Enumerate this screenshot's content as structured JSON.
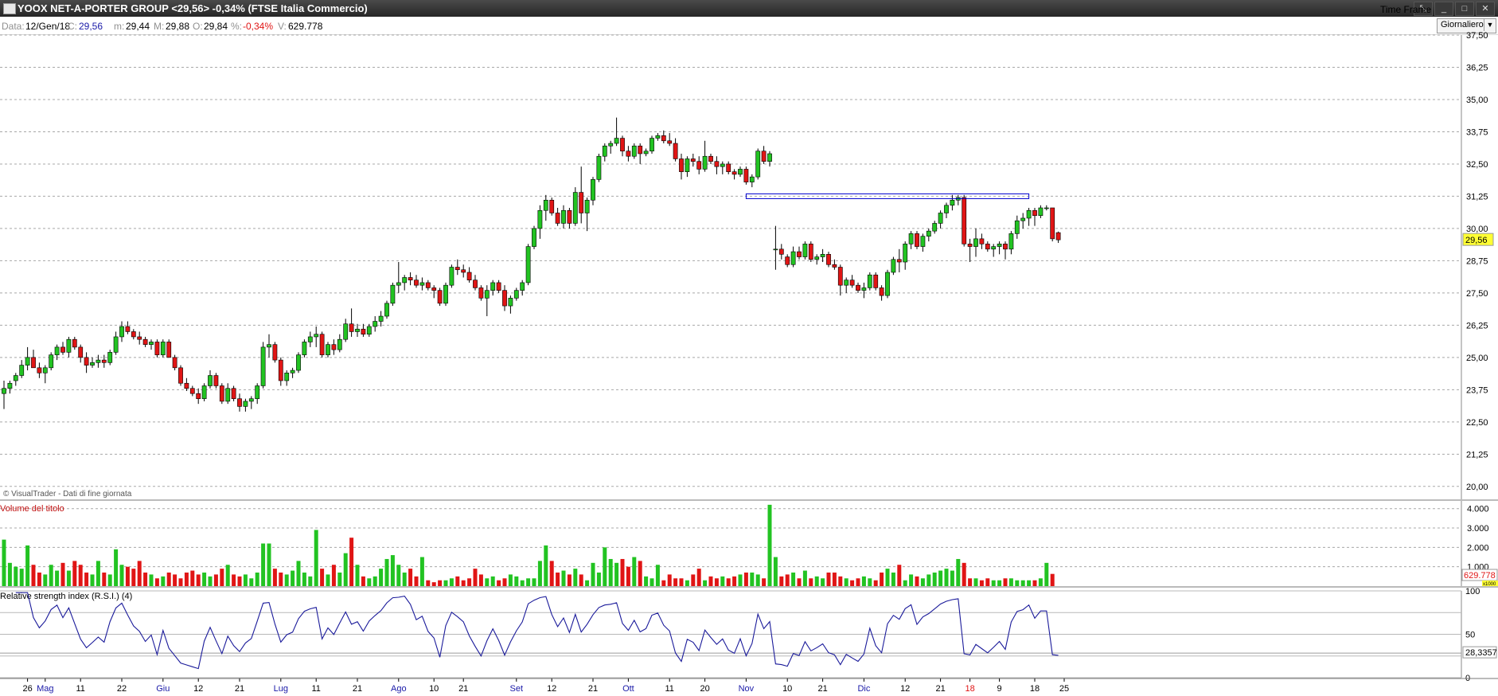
{
  "window": {
    "title": "YOOX NET-A-PORTER GROUP <29,56> -0,34%  (FTSE Italia Commercio)",
    "buttons": [
      "⤡",
      "_",
      "□",
      "✕"
    ]
  },
  "infobar": {
    "date_label": "Data:",
    "date_value": "12/Gen/18",
    "close_label": "C:",
    "close_value": "29,56",
    "min_label": "m:",
    "min_value": "29,44",
    "max_label": "M:",
    "max_value": "29,88",
    "open_label": "O:",
    "open_value": "29,84",
    "pct_label": "%:",
    "pct_value": "-0,34%",
    "vol_label": "V:",
    "vol_value": "629.778"
  },
  "timeframe": {
    "label": "Time Frame",
    "value": "Giornaliero"
  },
  "colors": {
    "up": "#22c322",
    "down": "#e01515",
    "rsi": "#1a1a9a",
    "resistance": "#0000cc",
    "last_price_bg": "#ffff33"
  },
  "chart_data": [
    {
      "type": "candlestick",
      "credit": "© VisualTrader - Dati di fine giornata",
      "ylim": [
        19.5,
        37.5
      ],
      "yticks": [
        "37,50",
        "36,25",
        "35,00",
        "33,75",
        "32,50",
        "31,25",
        "30,00",
        "28,75",
        "27,50",
        "26,25",
        "25,00",
        "23,75",
        "22,50",
        "21,25",
        "20,00"
      ],
      "grid": true,
      "last_price": "29,56",
      "resistance_line": {
        "from_x": 126,
        "to_x": 174,
        "y": 31.25
      },
      "x_labels": [
        {
          "x": 4,
          "label": "26",
          "month": false
        },
        {
          "x": 7,
          "label": "Mag",
          "month": true
        },
        {
          "x": 13,
          "label": "11",
          "month": false
        },
        {
          "x": 20,
          "label": "22",
          "month": false
        },
        {
          "x": 27,
          "label": "Giu",
          "month": true
        },
        {
          "x": 33,
          "label": "12",
          "month": false
        },
        {
          "x": 40,
          "label": "21",
          "month": false
        },
        {
          "x": 47,
          "label": "Lug",
          "month": true
        },
        {
          "x": 53,
          "label": "11",
          "month": false
        },
        {
          "x": 60,
          "label": "21",
          "month": false
        },
        {
          "x": 67,
          "label": "Ago",
          "month": true
        },
        {
          "x": 73,
          "label": "10",
          "month": false
        },
        {
          "x": 78,
          "label": "21",
          "month": false
        },
        {
          "x": 87,
          "label": "Set",
          "month": true
        },
        {
          "x": 93,
          "label": "12",
          "month": false
        },
        {
          "x": 100,
          "label": "21",
          "month": false
        },
        {
          "x": 106,
          "label": "Ott",
          "month": true
        },
        {
          "x": 113,
          "label": "11",
          "month": false
        },
        {
          "x": 119,
          "label": "20",
          "month": false
        },
        {
          "x": 126,
          "label": "Nov",
          "month": true
        },
        {
          "x": 133,
          "label": "10",
          "month": false
        },
        {
          "x": 139,
          "label": "21",
          "month": false
        },
        {
          "x": 146,
          "label": "Dic",
          "month": true
        },
        {
          "x": 153,
          "label": "12",
          "month": false
        },
        {
          "x": 159,
          "label": "21",
          "month": false
        },
        {
          "x": 164,
          "label": "18",
          "month": "year"
        },
        {
          "x": 169,
          "label": "9",
          "month": false
        },
        {
          "x": 175,
          "label": "18",
          "month": false
        },
        {
          "x": 180,
          "label": "25",
          "month": false
        }
      ],
      "ohlc": [
        [
          23.6,
          24.1,
          23.0,
          23.8
        ],
        [
          23.8,
          24.1,
          23.6,
          24.0
        ],
        [
          24.1,
          24.4,
          23.9,
          24.3
        ],
        [
          24.3,
          24.9,
          24.2,
          24.7
        ],
        [
          24.7,
          25.4,
          24.5,
          25.0
        ],
        [
          25.0,
          25.3,
          24.6,
          24.6
        ],
        [
          24.6,
          24.8,
          24.2,
          24.4
        ],
        [
          24.4,
          24.7,
          24.0,
          24.6
        ],
        [
          24.6,
          25.2,
          24.5,
          25.1
        ],
        [
          25.1,
          25.5,
          24.9,
          25.4
        ],
        [
          25.4,
          25.6,
          25.1,
          25.2
        ],
        [
          25.2,
          25.8,
          25.0,
          25.7
        ],
        [
          25.7,
          25.8,
          25.3,
          25.4
        ],
        [
          25.4,
          25.5,
          24.8,
          25.0
        ],
        [
          25.0,
          25.2,
          24.4,
          24.7
        ],
        [
          24.7,
          25.0,
          24.6,
          24.8
        ],
        [
          24.8,
          25.1,
          24.6,
          24.9
        ],
        [
          24.9,
          25.1,
          24.6,
          24.8
        ],
        [
          24.8,
          25.3,
          24.7,
          25.2
        ],
        [
          25.2,
          26.0,
          25.1,
          25.8
        ],
        [
          25.8,
          26.4,
          25.6,
          26.2
        ],
        [
          26.2,
          26.4,
          25.9,
          26.0
        ],
        [
          26.0,
          26.1,
          25.7,
          25.8
        ],
        [
          25.8,
          26.0,
          25.5,
          25.7
        ],
        [
          25.7,
          25.8,
          25.4,
          25.5
        ],
        [
          25.5,
          25.7,
          25.3,
          25.6
        ],
        [
          25.6,
          25.7,
          25.0,
          25.1
        ],
        [
          25.1,
          25.7,
          25.0,
          25.6
        ],
        [
          25.6,
          25.7,
          25.0,
          25.0
        ],
        [
          25.0,
          25.1,
          24.5,
          24.6
        ],
        [
          24.6,
          24.7,
          23.9,
          24.0
        ],
        [
          24.0,
          24.2,
          23.7,
          23.8
        ],
        [
          23.8,
          23.9,
          23.5,
          23.6
        ],
        [
          23.6,
          23.8,
          23.2,
          23.4
        ],
        [
          23.4,
          24.0,
          23.3,
          23.9
        ],
        [
          23.9,
          24.5,
          23.8,
          24.3
        ],
        [
          24.3,
          24.4,
          23.8,
          23.9
        ],
        [
          23.9,
          24.0,
          23.2,
          23.3
        ],
        [
          23.3,
          24.0,
          23.2,
          23.8
        ],
        [
          23.8,
          23.9,
          23.3,
          23.4
        ],
        [
          23.4,
          23.6,
          22.9,
          23.1
        ],
        [
          23.1,
          23.4,
          22.9,
          23.3
        ],
        [
          23.3,
          23.5,
          23.0,
          23.4
        ],
        [
          23.4,
          24.0,
          23.2,
          23.9
        ],
        [
          23.9,
          25.6,
          23.8,
          25.4
        ],
        [
          25.4,
          25.9,
          25.0,
          25.5
        ],
        [
          25.5,
          25.6,
          24.8,
          24.9
        ],
        [
          24.9,
          25.0,
          23.9,
          24.1
        ],
        [
          24.1,
          24.5,
          23.9,
          24.4
        ],
        [
          24.4,
          24.6,
          24.2,
          24.5
        ],
        [
          24.5,
          25.2,
          24.4,
          25.1
        ],
        [
          25.1,
          25.7,
          25.0,
          25.6
        ],
        [
          25.6,
          26.0,
          25.4,
          25.8
        ],
        [
          25.8,
          26.2,
          25.4,
          25.9
        ],
        [
          25.9,
          26.0,
          25.0,
          25.1
        ],
        [
          25.1,
          25.6,
          25.0,
          25.5
        ],
        [
          25.5,
          25.7,
          25.1,
          25.3
        ],
        [
          25.3,
          25.9,
          25.2,
          25.7
        ],
        [
          25.7,
          26.5,
          25.6,
          26.3
        ],
        [
          26.3,
          26.9,
          25.8,
          26.0
        ],
        [
          26.0,
          26.3,
          25.8,
          26.1
        ],
        [
          26.1,
          26.3,
          25.8,
          25.9
        ],
        [
          25.9,
          26.3,
          25.8,
          26.2
        ],
        [
          26.2,
          26.6,
          26.0,
          26.4
        ],
        [
          26.4,
          26.8,
          26.2,
          26.6
        ],
        [
          26.6,
          27.2,
          26.5,
          27.1
        ],
        [
          27.1,
          27.9,
          27.0,
          27.8
        ],
        [
          27.8,
          28.7,
          27.5,
          27.9
        ],
        [
          27.9,
          28.2,
          27.6,
          28.1
        ],
        [
          28.1,
          28.3,
          27.8,
          28.0
        ],
        [
          28.0,
          28.2,
          27.7,
          27.8
        ],
        [
          27.8,
          28.1,
          27.6,
          27.9
        ],
        [
          27.9,
          28.0,
          27.6,
          27.7
        ],
        [
          27.7,
          27.8,
          27.3,
          27.6
        ],
        [
          27.6,
          27.7,
          27.0,
          27.1
        ],
        [
          27.1,
          27.9,
          27.0,
          27.8
        ],
        [
          27.8,
          28.6,
          27.7,
          28.5
        ],
        [
          28.5,
          28.8,
          28.2,
          28.4
        ],
        [
          28.4,
          28.6,
          28.1,
          28.3
        ],
        [
          28.3,
          28.5,
          27.9,
          28.0
        ],
        [
          28.0,
          28.2,
          27.6,
          27.7
        ],
        [
          27.7,
          27.8,
          27.2,
          27.3
        ],
        [
          27.3,
          27.8,
          26.6,
          27.6
        ],
        [
          27.6,
          28.0,
          27.4,
          27.9
        ],
        [
          27.9,
          28.0,
          27.5,
          27.6
        ],
        [
          27.6,
          27.8,
          26.8,
          27.0
        ],
        [
          27.0,
          27.4,
          26.7,
          27.3
        ],
        [
          27.3,
          27.7,
          27.2,
          27.6
        ],
        [
          27.6,
          28.0,
          27.4,
          27.9
        ],
        [
          27.9,
          29.4,
          27.8,
          29.3
        ],
        [
          29.3,
          30.1,
          29.2,
          30.0
        ],
        [
          30.0,
          30.9,
          29.6,
          30.7
        ],
        [
          30.7,
          31.3,
          30.3,
          31.1
        ],
        [
          31.1,
          31.2,
          30.5,
          30.6
        ],
        [
          30.6,
          30.8,
          30.1,
          30.2
        ],
        [
          30.2,
          30.9,
          30.0,
          30.7
        ],
        [
          30.7,
          30.8,
          30.0,
          30.2
        ],
        [
          30.2,
          31.6,
          30.1,
          31.4
        ],
        [
          31.4,
          32.4,
          30.2,
          30.6
        ],
        [
          30.6,
          31.2,
          29.9,
          31.1
        ],
        [
          31.1,
          32.0,
          30.9,
          31.9
        ],
        [
          31.9,
          32.9,
          31.8,
          32.8
        ],
        [
          32.8,
          33.3,
          32.6,
          33.2
        ],
        [
          33.2,
          33.4,
          32.9,
          33.3
        ],
        [
          33.3,
          34.3,
          33.2,
          33.5
        ],
        [
          33.5,
          33.6,
          32.8,
          33.0
        ],
        [
          33.0,
          33.2,
          32.6,
          32.8
        ],
        [
          32.8,
          33.3,
          32.7,
          33.2
        ],
        [
          33.2,
          33.3,
          32.5,
          32.9
        ],
        [
          32.9,
          33.1,
          32.8,
          33.0
        ],
        [
          33.0,
          33.6,
          32.9,
          33.5
        ],
        [
          33.5,
          33.7,
          33.4,
          33.6
        ],
        [
          33.6,
          33.8,
          33.3,
          33.4
        ],
        [
          33.4,
          33.7,
          33.2,
          33.3
        ],
        [
          33.3,
          33.5,
          32.6,
          32.7
        ],
        [
          32.7,
          32.9,
          31.9,
          32.2
        ],
        [
          32.2,
          32.8,
          32.0,
          32.7
        ],
        [
          32.7,
          32.9,
          32.4,
          32.6
        ],
        [
          32.6,
          32.8,
          32.1,
          32.3
        ],
        [
          32.3,
          33.4,
          32.2,
          32.8
        ],
        [
          32.8,
          32.9,
          32.5,
          32.6
        ],
        [
          32.6,
          32.8,
          32.1,
          32.4
        ],
        [
          32.4,
          32.6,
          32.1,
          32.5
        ],
        [
          32.5,
          32.6,
          32.1,
          32.2
        ],
        [
          32.2,
          32.3,
          31.9,
          32.1
        ],
        [
          32.1,
          32.4,
          32.0,
          32.3
        ],
        [
          32.3,
          32.4,
          31.7,
          31.8
        ],
        [
          31.8,
          32.1,
          31.6,
          32.0
        ],
        [
          32.0,
          33.1,
          31.9,
          33.0
        ],
        [
          33.0,
          33.2,
          32.5,
          32.6
        ],
        [
          32.6,
          33.0,
          32.4,
          32.9
        ],
        [
          29.2,
          30.1,
          28.4,
          29.2
        ],
        [
          29.2,
          29.4,
          28.8,
          29.0
        ],
        [
          28.9,
          29.0,
          28.5,
          28.6
        ],
        [
          28.6,
          29.3,
          28.5,
          29.1
        ],
        [
          29.1,
          29.3,
          28.8,
          28.9
        ],
        [
          28.9,
          29.5,
          28.8,
          29.4
        ],
        [
          29.4,
          29.5,
          28.7,
          28.8
        ],
        [
          28.8,
          29.0,
          28.6,
          28.9
        ],
        [
          28.9,
          29.2,
          28.7,
          29.0
        ],
        [
          29.0,
          29.1,
          28.5,
          28.6
        ],
        [
          28.6,
          28.8,
          28.4,
          28.5
        ],
        [
          28.5,
          28.6,
          27.4,
          27.8
        ],
        [
          27.8,
          28.1,
          27.5,
          28.0
        ],
        [
          28.0,
          28.2,
          27.7,
          27.8
        ],
        [
          27.8,
          27.9,
          27.5,
          27.6
        ],
        [
          27.6,
          27.9,
          27.3,
          27.7
        ],
        [
          27.7,
          28.3,
          27.6,
          28.2
        ],
        [
          28.2,
          28.3,
          27.6,
          27.7
        ],
        [
          27.7,
          27.8,
          27.2,
          27.4
        ],
        [
          27.4,
          28.4,
          27.3,
          28.3
        ],
        [
          28.3,
          28.9,
          28.2,
          28.8
        ],
        [
          28.8,
          29.2,
          28.3,
          28.7
        ],
        [
          28.7,
          29.5,
          28.4,
          29.4
        ],
        [
          29.4,
          29.9,
          29.2,
          29.8
        ],
        [
          29.8,
          29.9,
          29.2,
          29.3
        ],
        [
          29.3,
          29.8,
          29.1,
          29.7
        ],
        [
          29.7,
          30.0,
          29.5,
          29.9
        ],
        [
          29.9,
          30.3,
          29.8,
          30.2
        ],
        [
          30.2,
          30.7,
          30.0,
          30.6
        ],
        [
          30.6,
          31.0,
          30.4,
          30.9
        ],
        [
          30.9,
          31.3,
          30.7,
          31.1
        ],
        [
          31.1,
          31.3,
          30.9,
          31.2
        ],
        [
          31.2,
          31.3,
          29.3,
          29.4
        ],
        [
          29.4,
          29.6,
          28.7,
          29.3
        ],
        [
          29.3,
          30.0,
          28.9,
          29.6
        ],
        [
          29.6,
          29.8,
          29.2,
          29.4
        ],
        [
          29.4,
          29.5,
          29.1,
          29.2
        ],
        [
          29.2,
          29.4,
          28.9,
          29.3
        ],
        [
          29.3,
          29.5,
          29.0,
          29.4
        ],
        [
          29.4,
          29.5,
          28.8,
          29.2
        ],
        [
          29.2,
          29.9,
          29.0,
          29.8
        ],
        [
          29.8,
          30.5,
          29.6,
          30.3
        ],
        [
          30.3,
          30.6,
          30.0,
          30.4
        ],
        [
          30.4,
          30.8,
          30.1,
          30.7
        ],
        [
          30.7,
          30.8,
          30.1,
          30.5
        ],
        [
          30.5,
          30.9,
          30.4,
          30.8
        ],
        [
          30.8,
          30.9,
          30.7,
          30.8
        ],
        [
          30.8,
          30.8,
          29.5,
          29.6
        ],
        [
          29.84,
          29.88,
          29.44,
          29.56
        ]
      ]
    },
    {
      "type": "bar",
      "title": "Volume del titolo",
      "ylim": [
        0,
        4400
      ],
      "yticks": [
        "4.000",
        "3.000",
        "2.000",
        "1.000"
      ],
      "last_value": "629.778",
      "last_value_scale": "x1000",
      "note": "bar colour follows the candle direction"
    },
    {
      "type": "line",
      "title": "Relative strength index (R.S.I.) (4)",
      "ylim": [
        0,
        100
      ],
      "yticks": [
        "100",
        "50",
        "0"
      ],
      "last_value": "28,3357",
      "reference_value": 28.3357,
      "grid_levels": [
        100,
        75,
        50,
        25,
        0
      ]
    }
  ]
}
